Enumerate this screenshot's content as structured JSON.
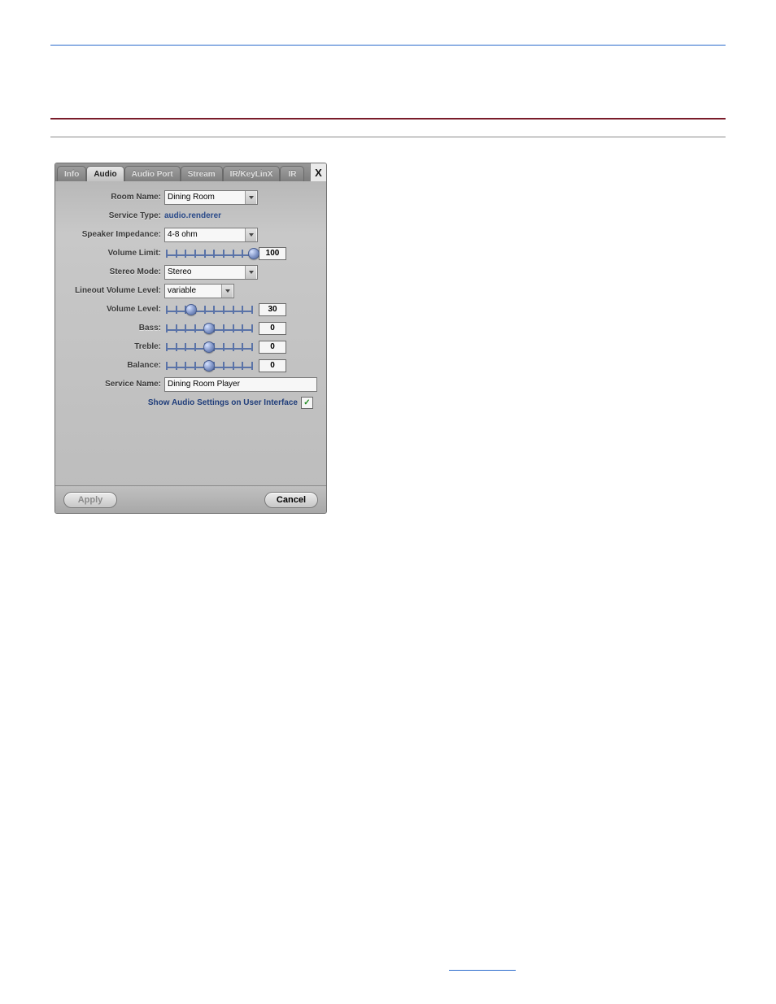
{
  "tabs": {
    "info": "Info",
    "audio": "Audio",
    "audio_port": "Audio Port",
    "stream": "Stream",
    "ir_keylinx": "IR/KeyLinX",
    "ir": "IR"
  },
  "close": "X",
  "labels": {
    "room_name": "Room Name:",
    "service_type": "Service Type:",
    "speaker_impedance": "Speaker Impedance:",
    "volume_limit": "Volume Limit:",
    "stereo_mode": "Stereo Mode:",
    "lineout_volume_level": "Lineout Volume Level:",
    "volume_level": "Volume Level:",
    "bass": "Bass:",
    "treble": "Treble:",
    "balance": "Balance:",
    "service_name": "Service Name:",
    "show_audio": "Show Audio Settings on User Interface"
  },
  "fields": {
    "room_name": "Dining Room",
    "service_type": "audio.renderer",
    "speaker_impedance": "4-8 ohm",
    "stereo_mode": "Stereo",
    "lineout_volume_level": "variable",
    "service_name": "Dining Room Player",
    "show_audio_checked": "✓"
  },
  "sliders": {
    "volume_limit": {
      "value": 100,
      "pct": 100
    },
    "volume_level": {
      "value": 30,
      "pct": 30
    },
    "bass": {
      "value": 0,
      "pct": 50
    },
    "treble": {
      "value": 0,
      "pct": 50
    },
    "balance": {
      "value": 0,
      "pct": 50
    }
  },
  "buttons": {
    "apply": "Apply",
    "cancel": "Cancel"
  }
}
